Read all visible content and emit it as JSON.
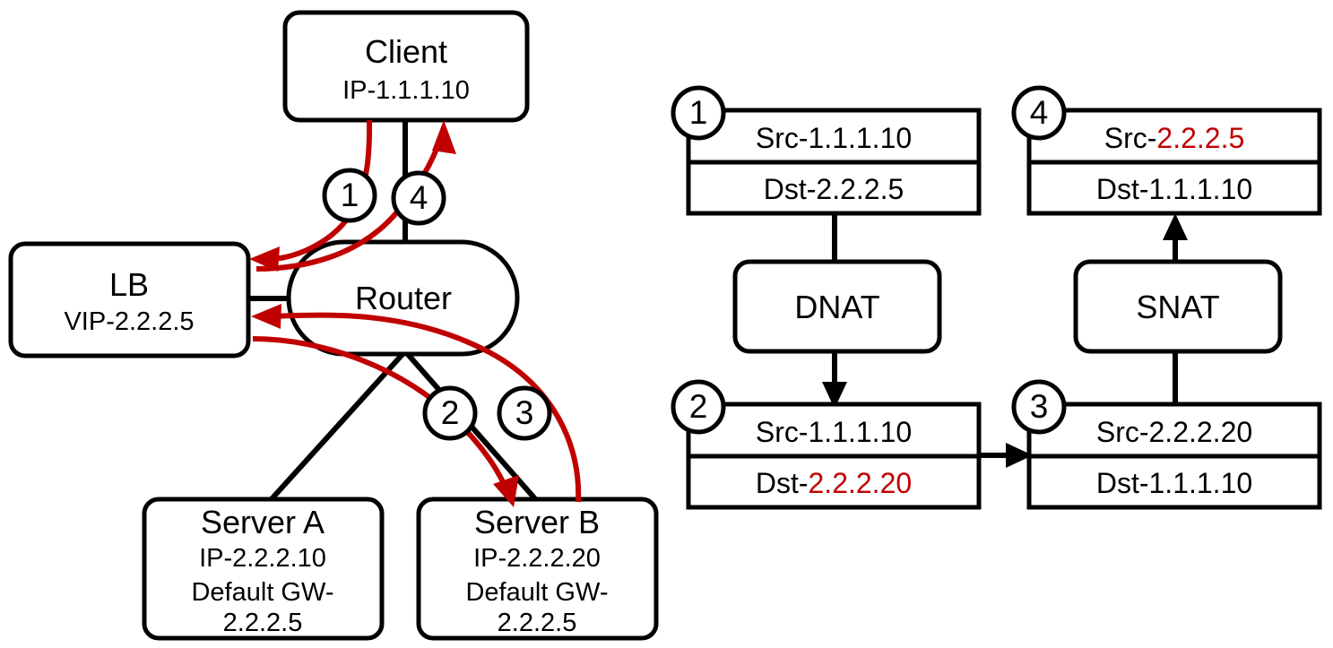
{
  "colors": {
    "stroke": "#000000",
    "flow": "#C00000",
    "highlight": "#C00000",
    "background": "#ffffff"
  },
  "topology": {
    "nodes": [
      {
        "id": "client",
        "title": "Client",
        "sub1": "IP-1.1.1.10",
        "sub2": "",
        "sub3": "",
        "shape": "rounded-rect"
      },
      {
        "id": "lb",
        "title": "LB",
        "sub1": "VIP-2.2.2.5",
        "sub2": "",
        "sub3": "",
        "shape": "rounded-rect"
      },
      {
        "id": "router",
        "title": "Router",
        "sub1": "",
        "sub2": "",
        "sub3": "",
        "shape": "stadium"
      },
      {
        "id": "server-a",
        "title": "Server A",
        "sub1": "IP-2.2.2.10",
        "sub2": "Default GW-",
        "sub3": "2.2.2.5",
        "shape": "rounded-rect"
      },
      {
        "id": "server-b",
        "title": "Server B",
        "sub1": "IP-2.2.2.20",
        "sub2": "Default GW-",
        "sub3": "2.2.2.5",
        "shape": "rounded-rect"
      }
    ],
    "flow_badges": [
      {
        "id": "badge-1",
        "label": "1",
        "from": "client",
        "to": "lb"
      },
      {
        "id": "badge-4",
        "label": "4",
        "from": "lb",
        "to": "client"
      },
      {
        "id": "badge-2",
        "label": "2",
        "from": "lb",
        "to": "server-b"
      },
      {
        "id": "badge-3",
        "label": "3",
        "from": "server-b",
        "to": "lb"
      }
    ]
  },
  "packet_flow": {
    "steps": [
      {
        "id": "packet-1",
        "badge": "1",
        "src_label": "Src-",
        "src_value": "1.1.1.10",
        "src_highlight": false,
        "dst_label": "Dst-",
        "dst_value": "2.2.2.5",
        "dst_highlight": false
      },
      {
        "id": "packet-4",
        "badge": "4",
        "src_label": "Src-",
        "src_value": "2.2.2.5",
        "src_highlight": true,
        "dst_label": "Dst-",
        "dst_value": "1.1.1.10",
        "dst_highlight": false
      },
      {
        "id": "packet-2",
        "badge": "2",
        "src_label": "Src-",
        "src_value": "1.1.1.10",
        "src_highlight": false,
        "dst_label": "Dst-",
        "dst_value": "2.2.2.20",
        "dst_highlight": true
      },
      {
        "id": "packet-3",
        "badge": "3",
        "src_label": "Src-",
        "src_value": "2.2.2.20",
        "src_highlight": false,
        "dst_label": "Dst-",
        "dst_value": "1.1.1.10",
        "dst_highlight": false
      }
    ],
    "operations": [
      {
        "id": "dnat-box",
        "label": "DNAT"
      },
      {
        "id": "snat-box",
        "label": "SNAT"
      }
    ]
  }
}
